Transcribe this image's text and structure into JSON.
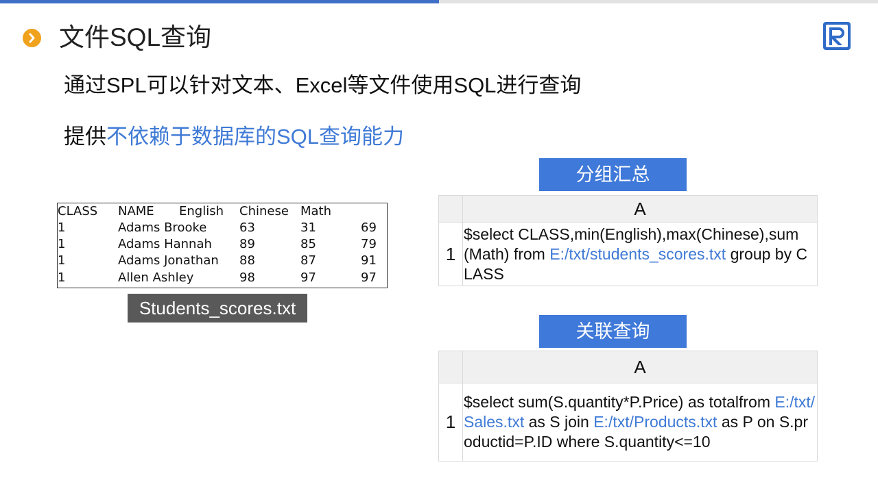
{
  "title": "文件SQL查询",
  "intro": {
    "line1": "通过SPL可以针对文本、Excel等文件使用SQL进行查询",
    "line2_prefix": "提供",
    "line2_accent": "不依赖于数据库的SQL查询能力"
  },
  "file_preview": {
    "headers": [
      "CLASS",
      "NAME",
      "English",
      "Chinese",
      "Math"
    ],
    "rows": [
      [
        "1",
        "Adams Brooke",
        "63",
        "31",
        "69"
      ],
      [
        "1",
        "Adams Hannah",
        "89",
        "85",
        "79"
      ],
      [
        "1",
        "Adams Jonathan",
        "88",
        "87",
        "91"
      ],
      [
        "1",
        "Allen Ashley",
        "98",
        "97",
        "97"
      ]
    ],
    "caption": "Students_scores.txt"
  },
  "group_section": {
    "label": "分组汇总",
    "col_header": "A",
    "row_number": "1",
    "code_before": "$select   CLASS,min(English),max(Chinese),sum(Math) from ",
    "path": "E:/txt/students_scores.txt",
    "code_after": "   group by CLASS"
  },
  "join_section": {
    "label": "关联查询",
    "col_header": "A",
    "row_number": "1",
    "code_part1": "$select   sum(S.quantity*P.Price) as totalfrom ",
    "path1": "E:/txt/Sales.txt",
    "code_part2": " as S   join ",
    "path2": "E:/txt/Products.txt",
    "code_part3": " as P on S.productid=P.ID where S.quantity<=10"
  },
  "colors": {
    "accent_blue": "#3f7ad6",
    "bullet_orange": "#f0a21c",
    "caption_gray": "#595959"
  },
  "icons": {
    "bullet": "chevron-right-icon",
    "logo": "r-logo-icon"
  }
}
